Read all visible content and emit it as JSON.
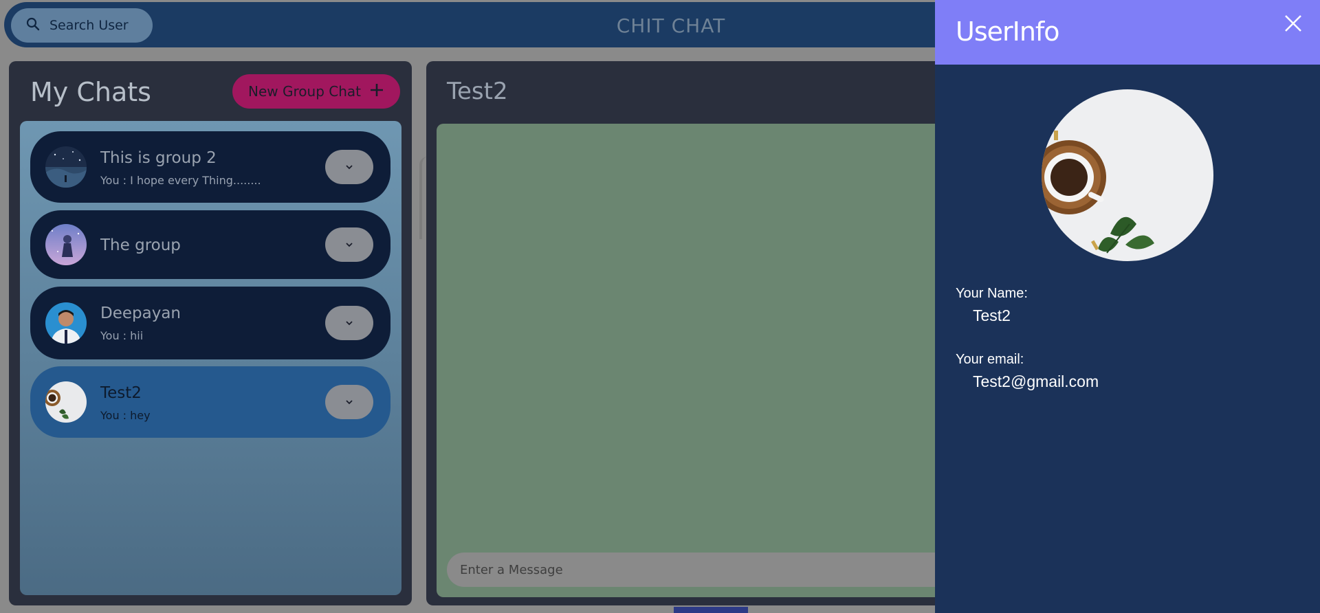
{
  "header": {
    "search_label": "Search User",
    "app_title": "CHIT CHAT"
  },
  "chats": {
    "title": "My Chats",
    "new_group_label": "New Group Chat",
    "items": [
      {
        "name": "This is group 2",
        "preview": "You : I hope every Thing........",
        "avatar": "starry-scene-avatar",
        "active": false
      },
      {
        "name": "The group",
        "preview": "",
        "avatar": "anime-girl-avatar",
        "active": false
      },
      {
        "name": "Deepayan",
        "preview": "You : hii",
        "avatar": "person-photo-avatar",
        "active": false
      },
      {
        "name": "Test2",
        "preview": "You : hey",
        "avatar": "coffee-cup-avatar",
        "active": true
      }
    ]
  },
  "conversation": {
    "title": "Test2",
    "input_placeholder": "Enter a Message"
  },
  "drawer": {
    "title": "UserInfo",
    "name_label": "Your Name:",
    "name_value": "Test2",
    "email_label": "Your email:",
    "email_value": "Test2@gmail.com"
  },
  "colors": {
    "topbar": "#1b3b63",
    "drawer_header": "#7f7ef7",
    "drawer_bg": "#1b3259",
    "new_group_button": "#a1175e",
    "active_chat": "#25598e",
    "messages_bg": "#6b8671"
  }
}
